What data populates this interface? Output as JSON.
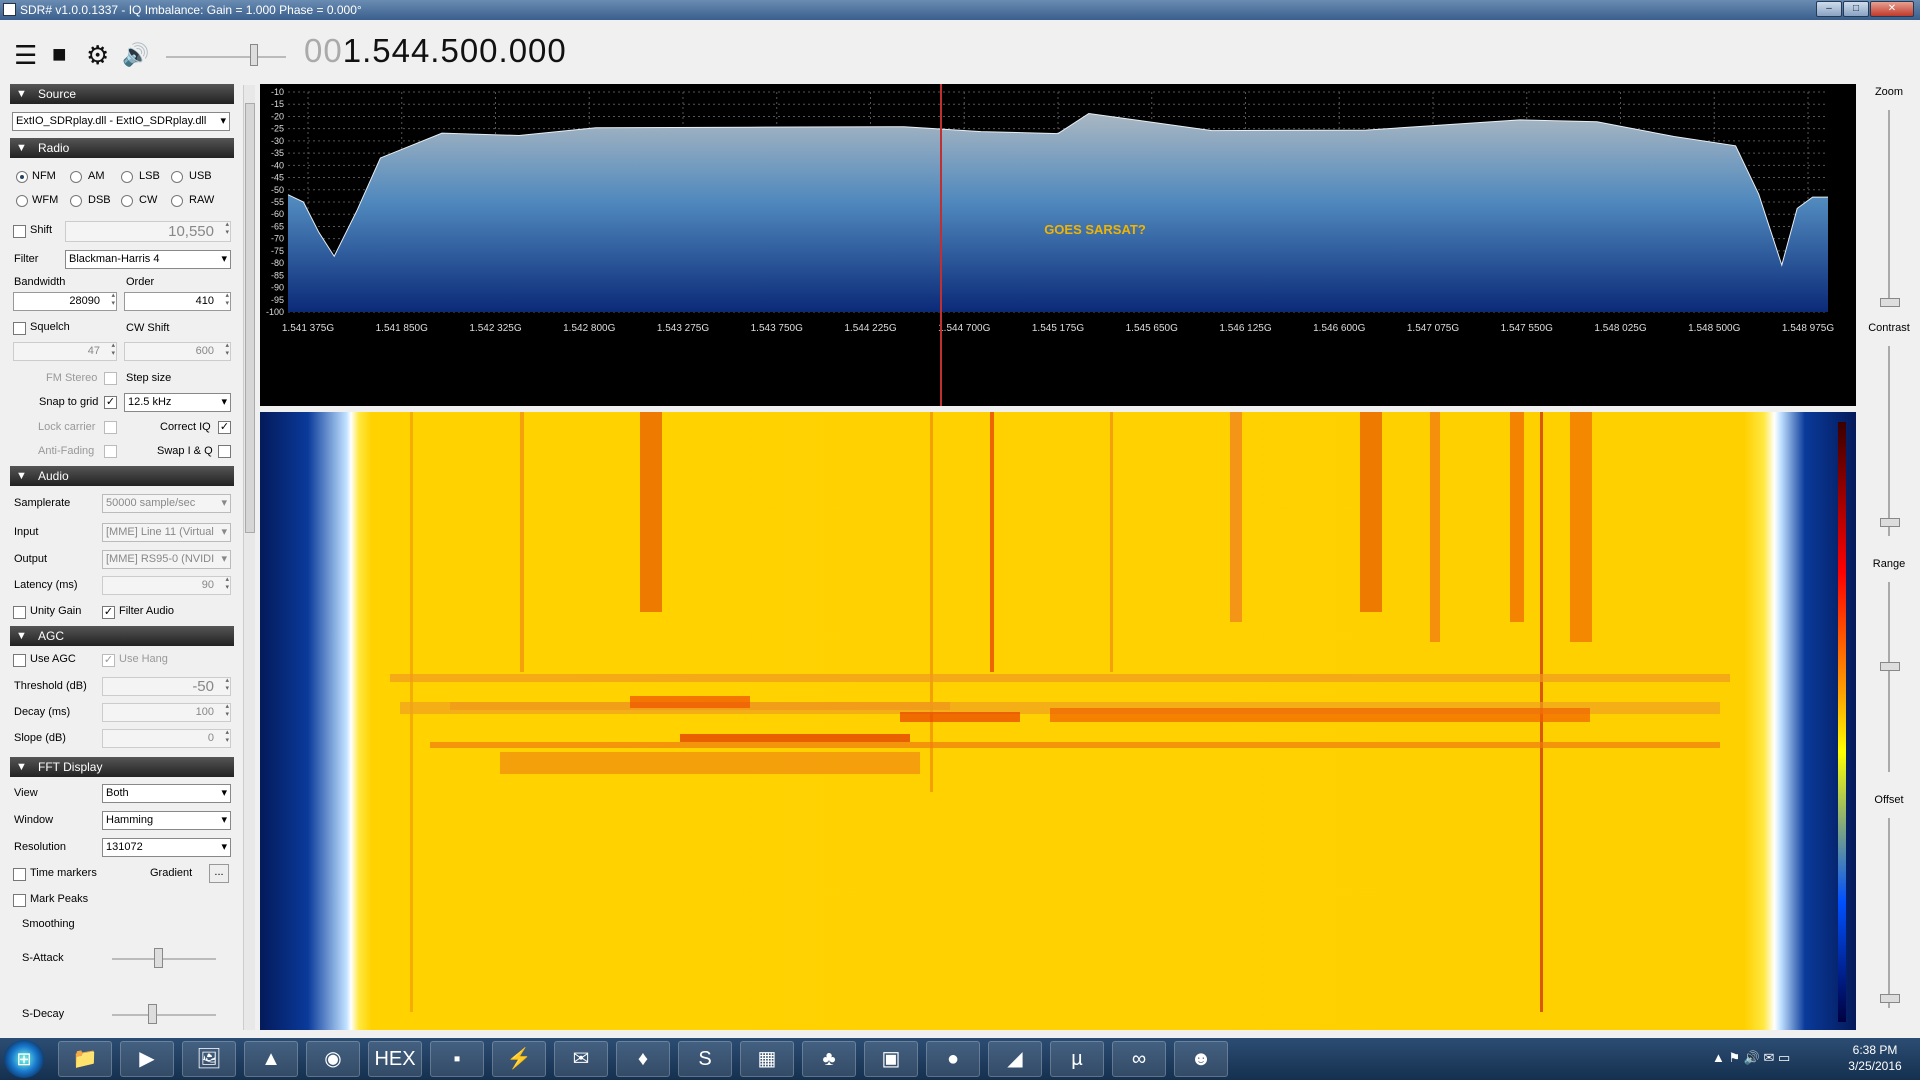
{
  "window": {
    "title": "SDR# v1.0.0.1337 - IQ Imbalance: Gain = 1.000 Phase = 0.000°",
    "minimize": "–",
    "maximize": "□",
    "close": "✕"
  },
  "toolbar": {
    "menu_icon": "☰",
    "stop_icon": "■",
    "settings_icon": "⚙",
    "volume_icon": "🔊",
    "freq_dim": "00",
    "freq_main": "1.544.500.000"
  },
  "source": {
    "header": "Source",
    "device": "ExtIO_SDRplay.dll - ExtIO_SDRplay.dll"
  },
  "radio": {
    "header": "Radio",
    "modes": [
      "NFM",
      "AM",
      "LSB",
      "USB",
      "WFM",
      "DSB",
      "CW",
      "RAW"
    ],
    "selected_mode": "NFM",
    "shift_label": "Shift",
    "shift_value": "10,550",
    "filter_label": "Filter",
    "filter_value": "Blackman-Harris 4",
    "bandwidth_label": "Bandwidth",
    "bandwidth_value": "28090",
    "order_label": "Order",
    "order_value": "410",
    "squelch_label": "Squelch",
    "squelch_value": "47",
    "cwshift_label": "CW Shift",
    "cwshift_value": "600",
    "fmstereo_label": "FM Stereo",
    "stepsize_label": "Step size",
    "snap_label": "Snap to grid",
    "step_value": "12.5 kHz",
    "lock_label": "Lock carrier",
    "correctiq_label": "Correct IQ",
    "antifading_label": "Anti-Fading",
    "swapiq_label": "Swap I & Q"
  },
  "audio": {
    "header": "Audio",
    "samplerate_label": "Samplerate",
    "samplerate_value": "50000 sample/sec",
    "input_label": "Input",
    "input_value": "[MME] Line 11 (Virtual",
    "output_label": "Output",
    "output_value": "[MME] RS95-0 (NVIDI",
    "latency_label": "Latency (ms)",
    "latency_value": "90",
    "unity_label": "Unity Gain",
    "filteraudio_label": "Filter Audio"
  },
  "agc": {
    "header": "AGC",
    "useagc_label": "Use AGC",
    "usehang_label": "Use Hang",
    "threshold_label": "Threshold (dB)",
    "threshold_value": "-50",
    "decay_label": "Decay (ms)",
    "decay_value": "100",
    "slope_label": "Slope (dB)",
    "slope_value": "0"
  },
  "fft": {
    "header": "FFT Display",
    "view_label": "View",
    "view_value": "Both",
    "window_label": "Window",
    "window_value": "Hamming",
    "resolution_label": "Resolution",
    "resolution_value": "131072",
    "timemarkers_label": "Time markers",
    "gradient_label": "Gradient",
    "gradient_btn": "...",
    "markpeaks_label": "Mark Peaks",
    "smoothing_label": "Smoothing",
    "sattack_label": "S-Attack",
    "sdecay_label": "S-Decay"
  },
  "right": {
    "zoom": "Zoom",
    "contrast": "Contrast",
    "range": "Range",
    "offset": "Offset"
  },
  "chart_data": {
    "type": "line",
    "title": "",
    "xlabel": "",
    "ylabel": "",
    "x_ticks": [
      "1.541 375G",
      "1.541 850G",
      "1.542 325G",
      "1.542 800G",
      "1.543 275G",
      "1.543 750G",
      "1.544 225G",
      "1.544 700G",
      "1.545 175G",
      "1.545 650G",
      "1.546 125G",
      "1.546 600G",
      "1.547 075G",
      "1.547 550G",
      "1.548 025G",
      "1.548 500G",
      "1.548 975G"
    ],
    "y_ticks": [
      "-10",
      "-15",
      "-20",
      "-25",
      "-30",
      "-35",
      "-40",
      "-45",
      "-50",
      "-55",
      "-60",
      "-65",
      "-70",
      "-75",
      "-80",
      "-85",
      "-90",
      "-95",
      "-100"
    ],
    "ylim": [
      -100,
      -10
    ],
    "grid": true,
    "annotation": "GOES SARSAT?",
    "series": [
      {
        "x": [
          0,
          0.01,
          0.02,
          0.03,
          0.045,
          0.06,
          0.1,
          0.15,
          0.2,
          0.3,
          0.4,
          0.45,
          0.5,
          0.52,
          0.6,
          0.7,
          0.8,
          0.85,
          0.9,
          0.94,
          0.955,
          0.97,
          0.98,
          0.99,
          1.0
        ],
        "y": [
          -52,
          -55,
          -68,
          -79,
          -57,
          -37,
          -28,
          -26,
          -24,
          -25,
          -26,
          -25,
          -27,
          -20,
          -24,
          -25,
          -22,
          -24,
          -27,
          -32,
          -53,
          -79,
          -57,
          -53,
          -53
        ]
      }
    ]
  },
  "taskbar": {
    "start_icon": "⊞",
    "apps": [
      "📁",
      "▶",
      "🖼",
      "▲",
      "◉",
      "HEX",
      "▪",
      "⚡",
      "✉",
      "♦",
      "S",
      "▦",
      "♣",
      "▣",
      "●",
      "◢",
      "µ",
      "∞",
      "☻"
    ]
  },
  "tray": {
    "icons": "▲ ⚑ 🔊 ✉ ▭"
  },
  "clock": {
    "time": "6:38 PM",
    "date": "3/25/2016"
  }
}
